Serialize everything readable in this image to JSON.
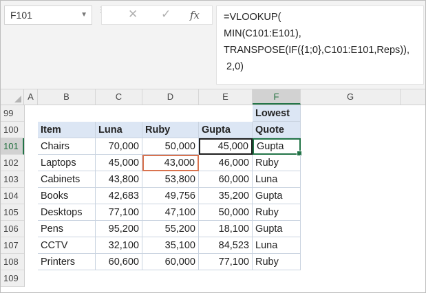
{
  "name_box": {
    "value": "F101",
    "dropdown_icon": "chevron-down-icon"
  },
  "formula_bar": {
    "cancel_icon": "close-icon",
    "enter_icon": "check-icon",
    "fx_label": "fx",
    "lines": [
      "=VLOOKUP(",
      "MIN(C101:E101),",
      "TRANSPOSE(IF({1;0},C101:E101,Reps)),",
      " 2,0)"
    ]
  },
  "columns": [
    "A",
    "B",
    "C",
    "D",
    "E",
    "F",
    "G"
  ],
  "rows": [
    "99",
    "100",
    "101",
    "102",
    "103",
    "104",
    "105",
    "106",
    "107",
    "108",
    "109"
  ],
  "header_row": {
    "above_f": "Lowest",
    "labels": [
      "Item",
      "Luna",
      "Ruby",
      "Gupta",
      "Quote"
    ]
  },
  "table": [
    [
      "Chairs",
      "70,000",
      "50,000",
      "45,000",
      "Gupta"
    ],
    [
      "Laptops",
      "45,000",
      "43,000",
      "46,000",
      "Ruby"
    ],
    [
      "Cabinets",
      "43,800",
      "53,800",
      "60,000",
      "Luna"
    ],
    [
      "Books",
      "42,683",
      "49,756",
      "35,200",
      "Gupta"
    ],
    [
      "Desktops",
      "77,100",
      "47,100",
      "50,000",
      "Ruby"
    ],
    [
      "Pens",
      "95,200",
      "55,200",
      "18,100",
      "Gupta"
    ],
    [
      "CCTV",
      "32,100",
      "35,100",
      "84,523",
      "Luna"
    ],
    [
      "Printers",
      "60,600",
      "60,000",
      "77,100",
      "Ruby"
    ]
  ],
  "colors": {
    "header_fill": "#dce6f4",
    "selection": "#217346",
    "highlight_red": "#d9734f"
  }
}
